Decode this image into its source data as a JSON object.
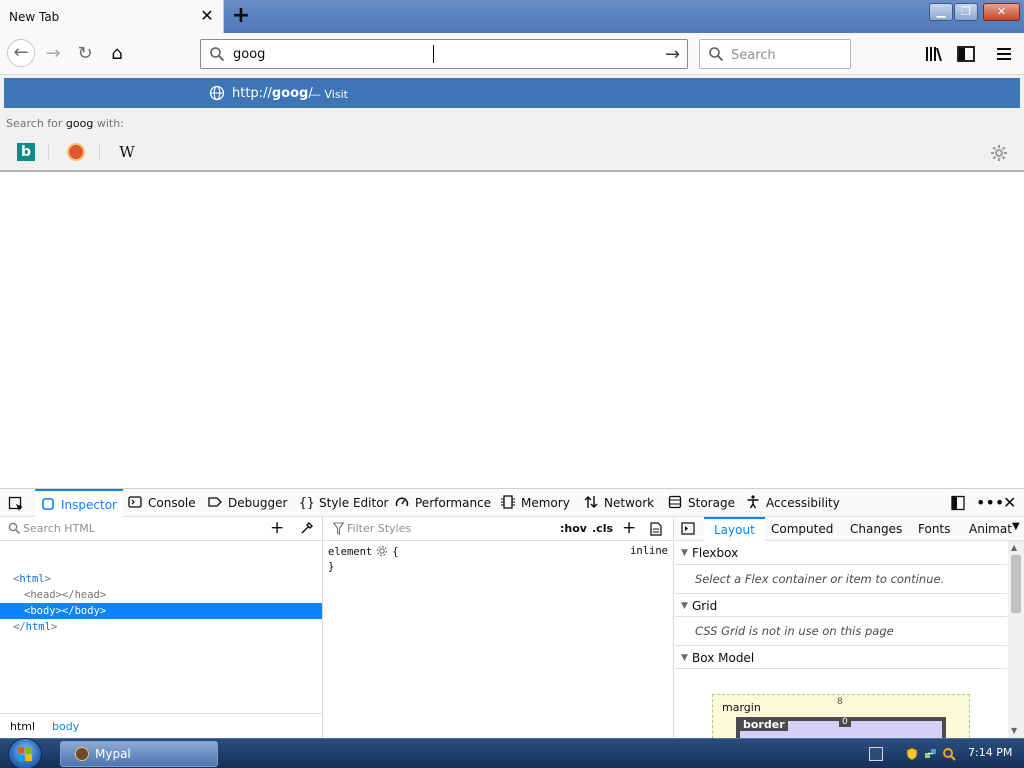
{
  "browser": {
    "tab": {
      "title": "New Tab",
      "close_glyph": "✕"
    },
    "new_tab_glyph": "+",
    "window_buttons": {
      "minimize": "▁",
      "maximize": "❐",
      "close": "✕"
    },
    "nav": {
      "back_glyph": "←",
      "forward_glyph": "→",
      "reload_glyph": "↻",
      "home_glyph": "⌂"
    },
    "urlbar": {
      "value": "goog",
      "go_glyph": "→"
    },
    "searchbar": {
      "placeholder": "Search"
    }
  },
  "dropdown": {
    "visit": {
      "url_prefix": "http://",
      "url_bold": "goog",
      "url_suffix": "/",
      "separator": "—",
      "action": "Visit"
    },
    "search_with": {
      "prefix": "Search for ",
      "term": "goog",
      "suffix": " with:"
    },
    "engines": [
      {
        "name": "bing-icon",
        "glyph": "b"
      },
      {
        "name": "duckduckgo-icon",
        "glyph": ""
      },
      {
        "name": "wikipedia-icon",
        "glyph": "W"
      }
    ]
  },
  "devtools": {
    "tabs": {
      "inspector": "Inspector",
      "console": "Console",
      "debugger": "Debugger",
      "style_editor": "Style Editor",
      "performance": "Performance",
      "memory": "Memory",
      "network": "Network",
      "storage": "Storage",
      "accessibility": "Accessibility"
    },
    "more_glyph": "•••",
    "close_glyph": "✕",
    "html": {
      "search_placeholder": "Search HTML",
      "add_glyph": "+",
      "nodes": {
        "html_open_lt": "<",
        "html_open": "html",
        "html_open_gt": ">",
        "head": "<head></head>",
        "body": "<body></body>",
        "html_close_lt": "</",
        "html_close": "html",
        "html_close_gt": ">"
      },
      "breadcrumbs": [
        "html",
        "body"
      ]
    },
    "rules": {
      "filter_placeholder": "Filter Styles",
      "hov": ":hov",
      "cls": ".cls",
      "add_glyph": "+",
      "selector": "element",
      "open_brace": "{",
      "close_brace": "}",
      "source": "inline"
    },
    "layout": {
      "tabs": {
        "layout": "Layout",
        "computed": "Computed",
        "changes": "Changes",
        "fonts": "Fonts",
        "animations": "Animat"
      },
      "more_glyph": "▼",
      "flexbox_title": "Flexbox",
      "flexbox_message": "Select a Flex container or item to continue.",
      "grid_title": "Grid",
      "grid_message": "CSS Grid is not in use on this page",
      "boxmodel_title": "Box Model",
      "boxmodel": {
        "margin_label": "margin",
        "margin_top": "8",
        "border_label": "border",
        "border_top": "0"
      }
    }
  },
  "taskbar": {
    "task_label": "Mypal",
    "clock": "7:14 PM"
  },
  "colors": {
    "accent": "#0a84ff",
    "visit_row": "#3d75b6",
    "selected_node": "#0a84ff",
    "titlebar": "#5d84c2"
  }
}
